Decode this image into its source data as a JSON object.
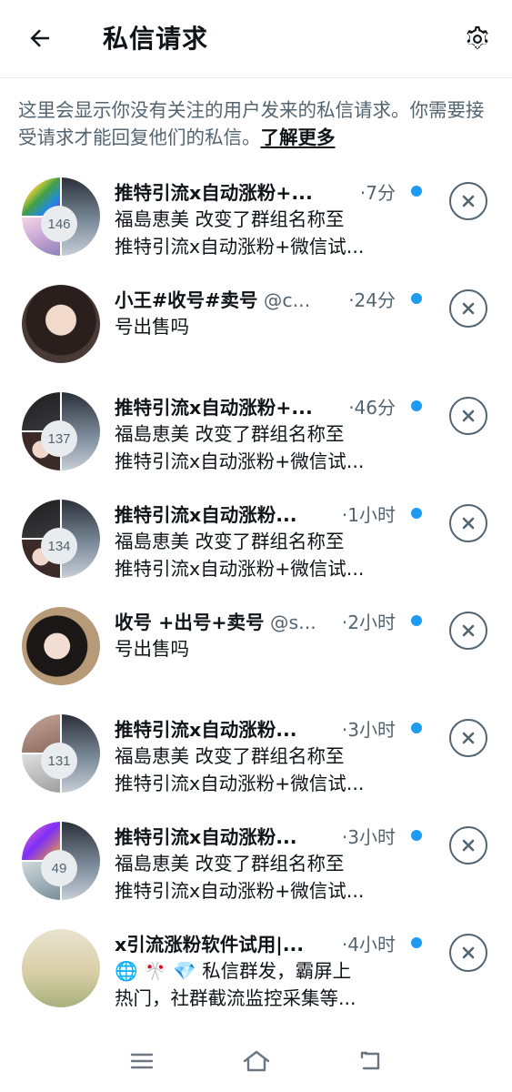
{
  "header": {
    "title": "私信请求",
    "back_icon": "arrow-left-icon",
    "settings_icon": "gear-icon"
  },
  "intro": {
    "text": "这里会显示你没有关注的用户发来的私信请求。你需要接受请求才能回复他们的私信。",
    "link": "了解更多"
  },
  "requests": [
    {
      "name": "推特引流x自动涨粉+...",
      "handle": "",
      "time": "·7分",
      "preview": [
        "福島恵美 改变了群组名称至",
        "推特引流x自动涨粉+微信试..."
      ],
      "members": "146",
      "unread": true
    },
    {
      "name": "小王#收号#卖号",
      "handle": "@c...",
      "time": "·24分",
      "preview": [
        "号出售吗"
      ],
      "members": "",
      "unread": true
    },
    {
      "name": "推特引流x自动涨粉+...",
      "handle": "",
      "time": "·46分",
      "preview": [
        "福島恵美 改变了群组名称至",
        "推特引流x自动涨粉+微信试..."
      ],
      "members": "137",
      "unread": true
    },
    {
      "name": "推特引流x自动涨粉...",
      "handle": "",
      "time": "·1小时",
      "preview": [
        "福島恵美 改变了群组名称至",
        "推特引流x自动涨粉+微信试..."
      ],
      "members": "134",
      "unread": true
    },
    {
      "name": "收号 +出号+卖号",
      "handle": "@s...",
      "time": "·2小时",
      "preview": [
        "号出售吗"
      ],
      "members": "",
      "unread": true
    },
    {
      "name": "推特引流x自动涨粉...",
      "handle": "",
      "time": "·3小时",
      "preview": [
        "福島恵美 改变了群组名称至",
        "推特引流x自动涨粉+微信试..."
      ],
      "members": "131",
      "unread": true
    },
    {
      "name": "推特引流x自动涨粉...",
      "handle": "",
      "time": "·3小时",
      "preview": [
        "福島恵美 改变了群组名称至",
        "推特引流x自动涨粉+微信试..."
      ],
      "members": "49",
      "unread": true
    },
    {
      "name": "x引流涨粉软件试用|...",
      "handle": "",
      "time": "·4小时",
      "preview": [
        "🌐 🎌 💎 私信群发，霸屏上",
        "热门，社群截流监控采集等..."
      ],
      "members": "",
      "unread": true
    }
  ],
  "colors": {
    "accent": "#1d9bf0",
    "secondary_text": "#536471",
    "primary_text": "#0f1419"
  },
  "system_nav": {
    "menu_icon": "menu-icon",
    "home_icon": "home-icon",
    "back_icon": "system-back-icon"
  }
}
